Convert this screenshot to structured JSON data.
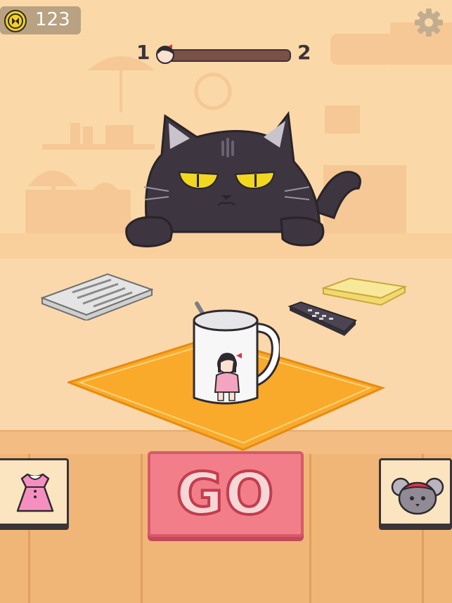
{
  "hud": {
    "coins": "123",
    "level_current": "1",
    "level_next": "2",
    "level_progress": 0.0
  },
  "buttons": {
    "go_label": "GO"
  },
  "icons": {
    "coin": "coin-icon",
    "settings": "gear-icon",
    "dress": "dress-icon",
    "mouse": "mouse-icon"
  },
  "colors": {
    "wall": "#fbd8a8",
    "table": "#fbd8ab",
    "floor": "#f0b678",
    "go_button": "#f27e8a",
    "cat": "#3d3540",
    "napkin": "#f9aa2a"
  }
}
